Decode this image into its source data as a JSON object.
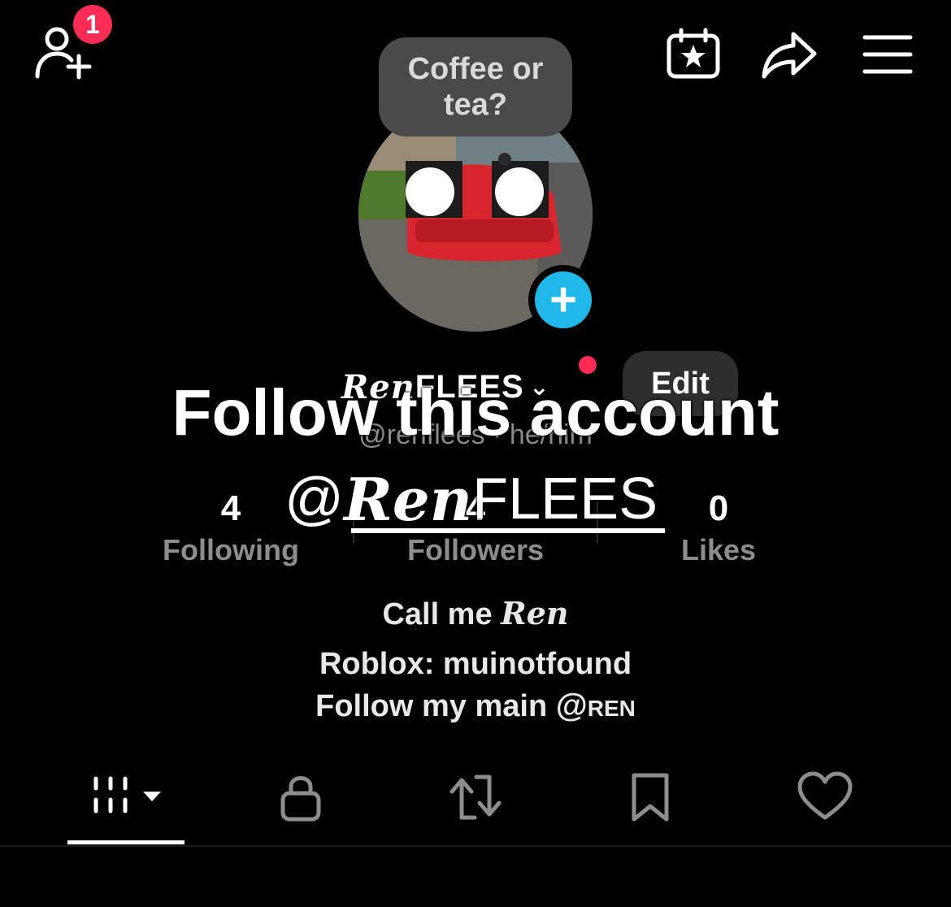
{
  "header": {
    "notification_count": "1",
    "icons": [
      "add-friend-icon",
      "calendar-star-icon",
      "share-icon",
      "menu-icon"
    ]
  },
  "note": {
    "text": "Coffee or tea?"
  },
  "profile": {
    "username_script": "Ren",
    "username_rest": "FLEES",
    "edit_label": "Edit",
    "handle_line": "@renflees · he/him"
  },
  "overlay": {
    "title": "Follow this account",
    "handle_at": "@",
    "handle_script": "Ren",
    "handle_rest": "FLEES"
  },
  "stats": [
    {
      "value": "4",
      "label": "Following"
    },
    {
      "value": "4",
      "label": "Followers"
    },
    {
      "value": "0",
      "label": "Likes"
    }
  ],
  "bio": {
    "line1_prefix": "Call me ",
    "line1_script": "Ren",
    "line2": "Roblox: muinotfound",
    "line3_prefix": "Follow my main ",
    "line3_mention": "@ren"
  },
  "tabs": [
    {
      "name": "videos",
      "icon": "grid-icon",
      "active": true
    },
    {
      "name": "private",
      "icon": "lock-icon",
      "active": false
    },
    {
      "name": "reposts",
      "icon": "repost-icon",
      "active": false
    },
    {
      "name": "favorites",
      "icon": "bookmark-icon",
      "active": false
    },
    {
      "name": "liked",
      "icon": "heart-icon",
      "active": false
    }
  ],
  "colors": {
    "background": "#000000",
    "badge": "#fe2c55",
    "add_story": "#20b8e8",
    "secondary_text": "#8d8d8d"
  }
}
